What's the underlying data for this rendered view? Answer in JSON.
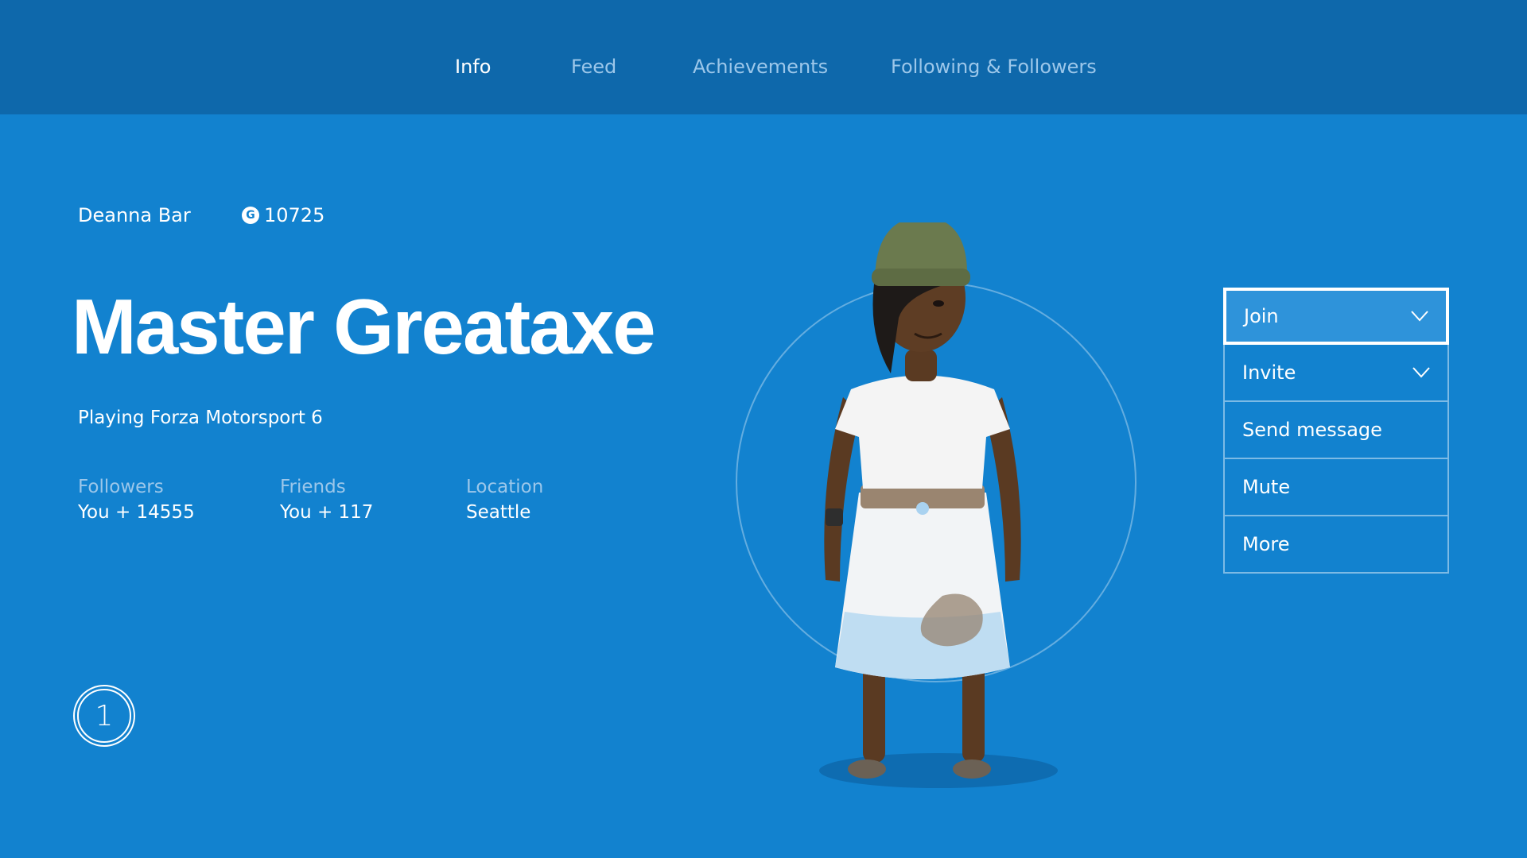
{
  "tabs": [
    {
      "label": "Info",
      "active": true
    },
    {
      "label": "Feed",
      "active": false
    },
    {
      "label": "Achievements",
      "active": false
    },
    {
      "label": "Following & Followers",
      "active": false
    }
  ],
  "profile": {
    "real_name": "Deanna Bar",
    "gamerscore_icon": "G",
    "gamerscore": "10725",
    "gamertag": "Master Greataxe",
    "presence": "Playing Forza Motorsport 6",
    "stats": [
      {
        "label": "Followers",
        "value": "You + 14555"
      },
      {
        "label": "Friends",
        "value": "You + 117"
      },
      {
        "label": "Location",
        "value": "Seattle"
      }
    ],
    "badge": "1"
  },
  "actions": [
    {
      "label": "Join",
      "dropdown": true,
      "focused": true
    },
    {
      "label": "Invite",
      "dropdown": true,
      "focused": false
    },
    {
      "label": "Send message",
      "dropdown": false,
      "focused": false
    },
    {
      "label": "Mute",
      "dropdown": false,
      "focused": false
    },
    {
      "label": "More",
      "dropdown": false,
      "focused": false
    }
  ],
  "colors": {
    "background": "#1282CF",
    "topbar": "#0E68AB",
    "inactive_text": "#9CC7EA"
  }
}
